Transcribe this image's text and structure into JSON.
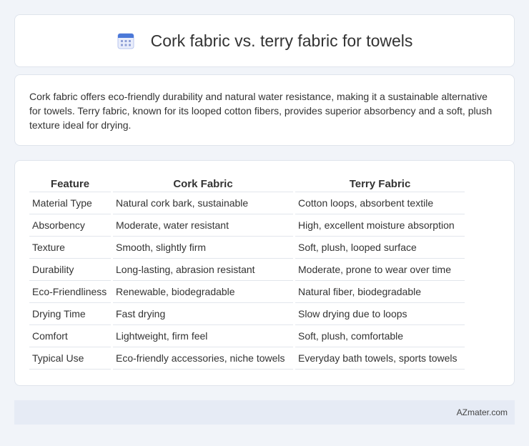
{
  "header": {
    "title": "Cork fabric vs. terry fabric for towels",
    "icon": "calendar-icon"
  },
  "intro": {
    "text": "Cork fabric offers eco-friendly durability and natural water resistance, making it a sustainable alternative for towels. Terry fabric, known for its looped cotton fibers, provides superior absorbency and a soft, plush texture ideal for drying."
  },
  "table": {
    "headers": [
      "Feature",
      "Cork Fabric",
      "Terry Fabric"
    ],
    "rows": [
      [
        "Material Type",
        "Natural cork bark, sustainable",
        "Cotton loops, absorbent textile"
      ],
      [
        "Absorbency",
        "Moderate, water resistant",
        "High, excellent moisture absorption"
      ],
      [
        "Texture",
        "Smooth, slightly firm",
        "Soft, plush, looped surface"
      ],
      [
        "Durability",
        "Long-lasting, abrasion resistant",
        "Moderate, prone to wear over time"
      ],
      [
        "Eco-Friendliness",
        "Renewable, biodegradable",
        "Natural fiber, biodegradable"
      ],
      [
        "Drying Time",
        "Fast drying",
        "Slow drying due to loops"
      ],
      [
        "Comfort",
        "Lightweight, firm feel",
        "Soft, plush, comfortable"
      ],
      [
        "Typical Use",
        "Eco-friendly accessories, niche towels",
        "Everyday bath towels, sports towels"
      ]
    ]
  },
  "footer": {
    "text": "AZmater.com"
  },
  "colors": {
    "background": "#f1f4f9",
    "card": "#ffffff",
    "footer_bg": "#e6ebf5",
    "icon_blue": "#4a78d8"
  }
}
